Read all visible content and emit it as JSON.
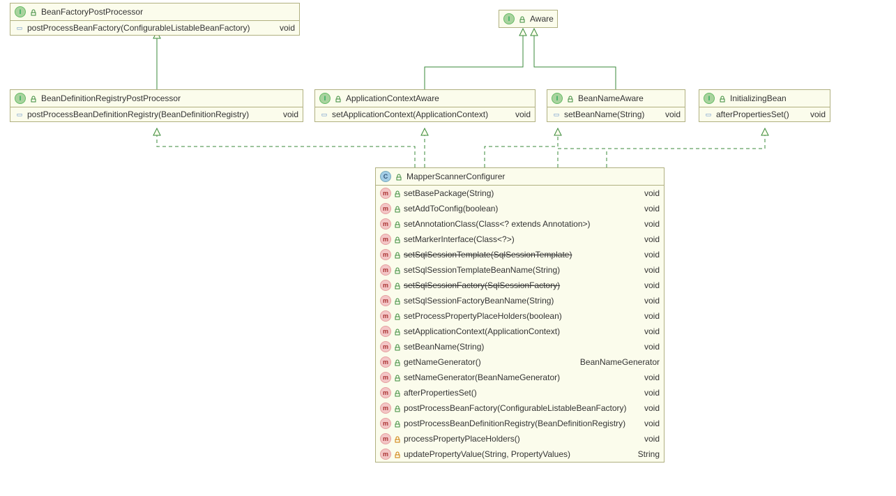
{
  "boxes": {
    "bfpp": {
      "title": "BeanFactoryPostProcessor",
      "member": {
        "name": "postProcessBeanFactory(ConfigurableListableBeanFactory)",
        "ret": "void"
      }
    },
    "bdrpp": {
      "title": "BeanDefinitionRegistryPostProcessor",
      "member": {
        "name": "postProcessBeanDefinitionRegistry(BeanDefinitionRegistry)",
        "ret": "void"
      }
    },
    "aware": {
      "title": "Aware"
    },
    "aca": {
      "title": "ApplicationContextAware",
      "member": {
        "name": "setApplicationContext(ApplicationContext)",
        "ret": "void"
      }
    },
    "bna": {
      "title": "BeanNameAware",
      "member": {
        "name": "setBeanName(String)",
        "ret": "void"
      }
    },
    "ib": {
      "title": "InitializingBean",
      "member": {
        "name": "afterPropertiesSet()",
        "ret": "void"
      }
    },
    "msc": {
      "title": "MapperScannerConfigurer",
      "members": [
        {
          "name": "setBasePackage(String)",
          "ret": "void",
          "lock": "green"
        },
        {
          "name": "setAddToConfig(boolean)",
          "ret": "void",
          "lock": "green"
        },
        {
          "name": "setAnnotationClass(Class<? extends Annotation>)",
          "ret": "void",
          "lock": "green"
        },
        {
          "name": "setMarkerInterface(Class<?>)",
          "ret": "void",
          "lock": "green"
        },
        {
          "name": "setSqlSessionTemplate(SqlSessionTemplate)",
          "ret": "void",
          "lock": "green",
          "deprecated": true
        },
        {
          "name": "setSqlSessionTemplateBeanName(String)",
          "ret": "void",
          "lock": "green"
        },
        {
          "name": "setSqlSessionFactory(SqlSessionFactory)",
          "ret": "void",
          "lock": "green",
          "deprecated": true
        },
        {
          "name": "setSqlSessionFactoryBeanName(String)",
          "ret": "void",
          "lock": "green"
        },
        {
          "name": "setProcessPropertyPlaceHolders(boolean)",
          "ret": "void",
          "lock": "green"
        },
        {
          "name": "setApplicationContext(ApplicationContext)",
          "ret": "void",
          "lock": "green"
        },
        {
          "name": "setBeanName(String)",
          "ret": "void",
          "lock": "green"
        },
        {
          "name": "getNameGenerator()",
          "ret": "BeanNameGenerator",
          "lock": "green"
        },
        {
          "name": "setNameGenerator(BeanNameGenerator)",
          "ret": "void",
          "lock": "green"
        },
        {
          "name": "afterPropertiesSet()",
          "ret": "void",
          "lock": "green"
        },
        {
          "name": "postProcessBeanFactory(ConfigurableListableBeanFactory)",
          "ret": "void",
          "lock": "green"
        },
        {
          "name": "postProcessBeanDefinitionRegistry(BeanDefinitionRegistry)",
          "ret": "void",
          "lock": "green"
        },
        {
          "name": "processPropertyPlaceHolders()",
          "ret": "void",
          "lock": "orange"
        },
        {
          "name": "updatePropertyValue(String, PropertyValues)",
          "ret": "String",
          "lock": "orange"
        }
      ]
    }
  }
}
